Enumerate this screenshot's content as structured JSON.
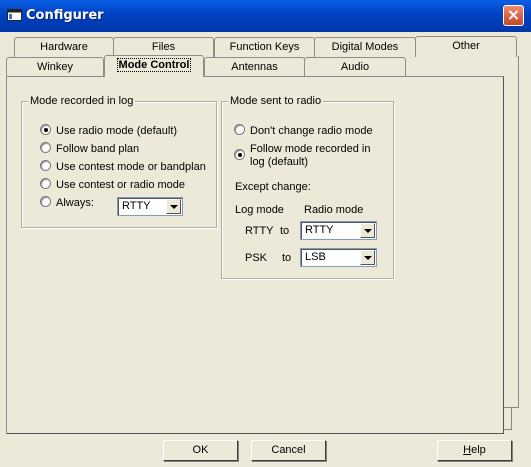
{
  "window": {
    "title": "Configurer",
    "close_glyph": "×"
  },
  "tabs_row1": [
    "Hardware",
    "Files",
    "Function Keys",
    "Digital Modes",
    "Other"
  ],
  "tabs_row2": [
    "Winkey",
    "Mode Control",
    "Antennas",
    "Audio"
  ],
  "mode_log": {
    "title": "Mode recorded in log",
    "options": [
      "Use radio mode (default)",
      "Follow band plan",
      "Use contest mode or bandplan",
      "Use contest or radio mode",
      "Always:"
    ],
    "selected_index": 0,
    "always_value": "RTTY"
  },
  "mode_radio": {
    "title": "Mode sent to radio",
    "option1": "Don't change radio mode",
    "option2_line1": "Follow mode recorded in",
    "option2_line2": "log (default)",
    "selected_index": 1,
    "except_label": "Except change:",
    "col_log": "Log mode",
    "col_radio": "Radio mode",
    "rules": [
      {
        "from": "RTTY",
        "to_label": "to",
        "value": "RTTY"
      },
      {
        "from": "PSK",
        "to_label": "to",
        "value": "LSB"
      }
    ]
  },
  "buttons": {
    "ok": "OK",
    "cancel": "Cancel",
    "help_first": "H",
    "help_rest": "elp"
  }
}
